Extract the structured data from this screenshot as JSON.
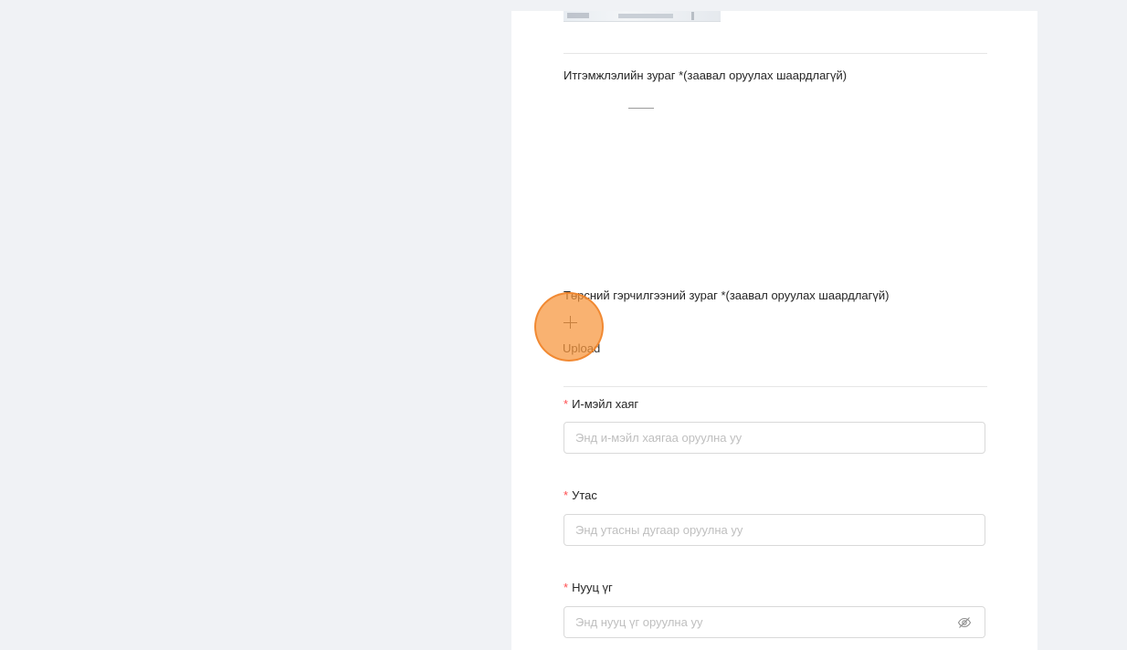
{
  "form": {
    "power_of_attorney_label": "Итгэмжлэлийн зураг *(заавал оруулах шаардлагүй)",
    "director_id_label": "Төрсний гэрчилгээний зураг *(заавал оруулах шаардлагүй)",
    "upload_label": "Upload",
    "required_mark": "*",
    "email": {
      "label": "И-мэйл хаяг",
      "placeholder": "Энд и-мэйл хаягаа оруулна уу",
      "value": ""
    },
    "phone": {
      "label": "Утас",
      "placeholder": "Энд утасны дугаар оруулна уу",
      "value": ""
    },
    "password": {
      "label": "Нууц үг",
      "placeholder": "Энд нууц үг оруулна уу",
      "value": ""
    }
  },
  "icons": {
    "upload": "plus-icon",
    "password_toggle": "eye-slash-icon"
  },
  "colors": {
    "background": "#f0f2f5",
    "required": "#ff4d4f",
    "border": "#d9d9d9",
    "placeholder": "#bfbfbf",
    "cursor_highlight": "#f7943a"
  }
}
